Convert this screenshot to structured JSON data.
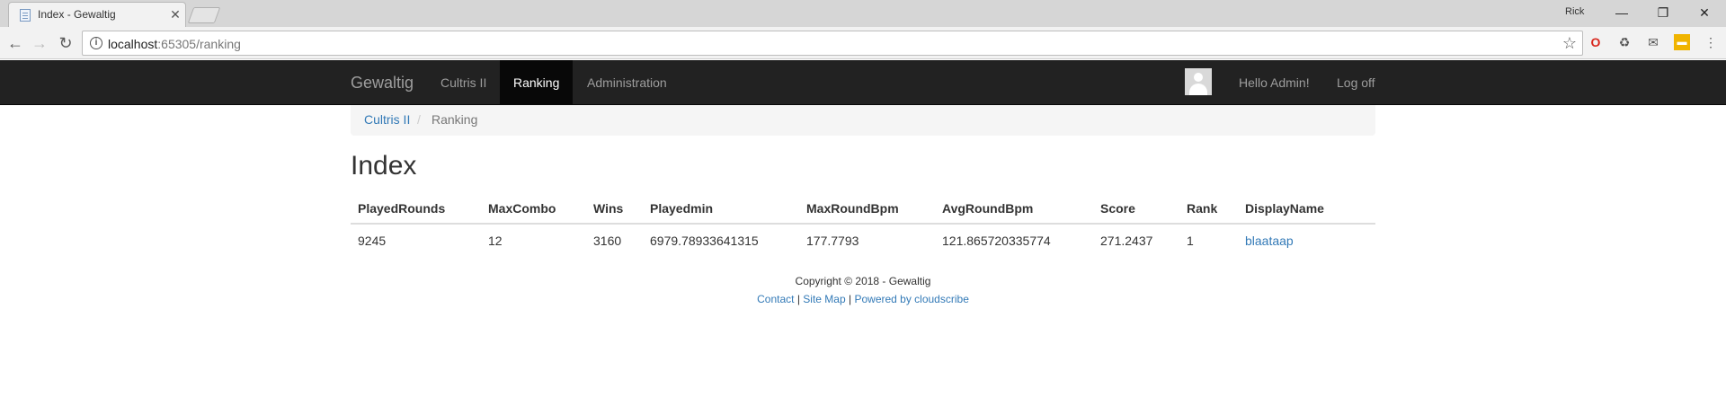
{
  "browser": {
    "tab_title": "Index - Gewaltig",
    "profile_name": "Rick",
    "url_host": "localhost",
    "url_rest": ":65305/ranking"
  },
  "navbar": {
    "brand": "Gewaltig",
    "links": [
      {
        "label": "Cultris II",
        "active": false
      },
      {
        "label": "Ranking",
        "active": true
      },
      {
        "label": "Administration",
        "active": false
      }
    ],
    "greeting": "Hello Admin!",
    "logoff": "Log off"
  },
  "breadcrumb": {
    "parent": "Cultris II",
    "separator": "/",
    "current": "Ranking"
  },
  "page": {
    "title": "Index"
  },
  "table": {
    "columns": [
      "PlayedRounds",
      "MaxCombo",
      "Wins",
      "Playedmin",
      "MaxRoundBpm",
      "AvgRoundBpm",
      "Score",
      "Rank",
      "DisplayName"
    ],
    "rows": [
      [
        "9245",
        "12",
        "3160",
        "6979.78933641315",
        "177.7793",
        "121.865720335774",
        "271.2437",
        "1",
        "blaataap"
      ]
    ]
  },
  "footer": {
    "copyright": "Copyright © 2018 - Gewaltig",
    "contact": "Contact",
    "sitemap": "Site Map",
    "powered": "Powered by cloudscribe",
    "separator": "|"
  },
  "colors": {
    "navbar_bg": "#222222",
    "navbar_active": "#080808",
    "link": "#337ab7",
    "breadcrumb_bg": "#f5f5f5"
  }
}
